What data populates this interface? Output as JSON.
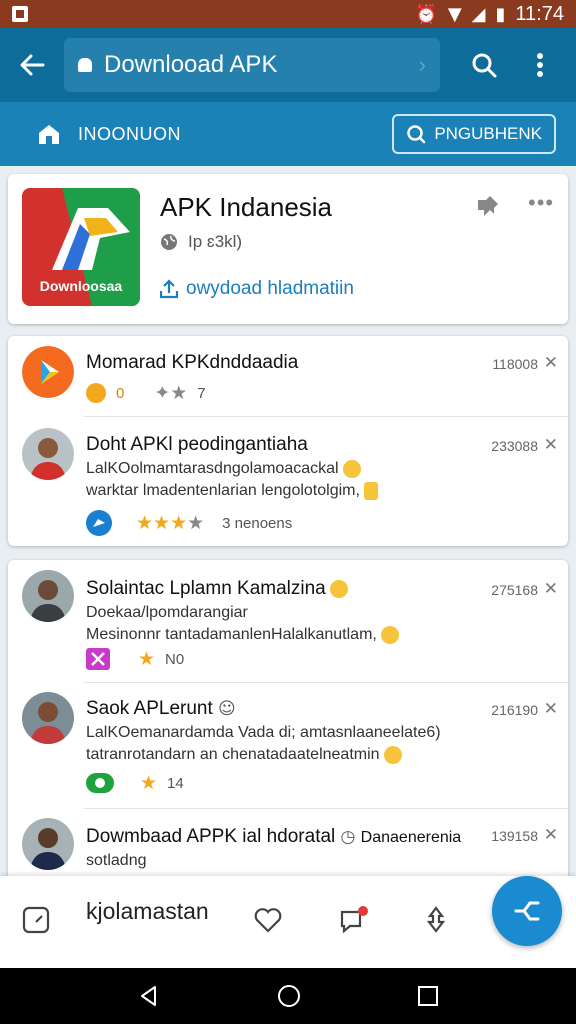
{
  "status_bar": {
    "time": "11:74"
  },
  "toolbar": {
    "title": "Downlooad APK",
    "chevron": "›",
    "back_icon": "arrow-left-icon",
    "search_icon": "search-icon",
    "menu_icon": "more-vert-icon"
  },
  "subbar": {
    "label": "INOONUON",
    "button_label": "PNGUBHENK"
  },
  "app_card": {
    "logo_text": "Downloosaa",
    "name": "APK Indanesia",
    "meta": "Ip ɛ3kl)",
    "download_label": "owydoad hladmatiin",
    "more_label": "•••"
  },
  "list1": [
    {
      "title": "Momarad KPKdnddaadia",
      "num": "118008",
      "reactions": "0",
      "stars": "7"
    },
    {
      "title": "Doht APKl peodingantiaha",
      "num": "233088",
      "line1": "LalKOolmamtarasdngolamoacackal",
      "line2": "warktar lmadentenlarian lengolotolgim,",
      "rating": "3 nenoens"
    }
  ],
  "list2": [
    {
      "title": "Solaintac Lplamn Kamalzina",
      "num": "275168",
      "line1": "Doekaa/lpomdarangiar",
      "line2": "Mesinonnr tantadamanlenHalalkanutlam,",
      "stars": "N0"
    },
    {
      "title": "Saok APLerunt",
      "num": "216190",
      "line1": "LalKOemanardamda  Vada di; amtasnlaaneelate6)",
      "line2": "tatranrotandarn an chenatadaatelneatmin",
      "stars": "14"
    },
    {
      "title": "Dowmbaad APPK ial hdoratal",
      "num": "139158",
      "extra": "Danaenerenia",
      "line1": "sotladng"
    }
  ],
  "bottom_bar": {
    "label": "kjolamastan"
  },
  "colors": {
    "status_bar": "#8a3a1e",
    "toolbar": "#0e6c9a",
    "subbar": "#1b82b8",
    "accent": "#1a8bd0",
    "star": "#f4a81d"
  }
}
